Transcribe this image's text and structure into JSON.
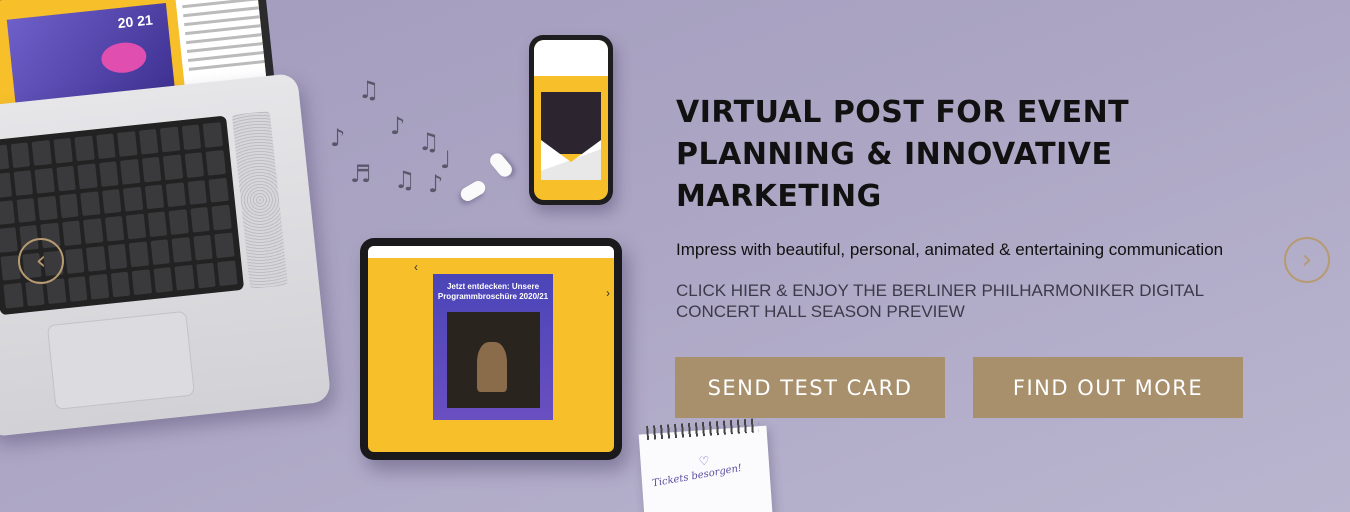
{
  "hero": {
    "headline": "VIRTUAL POST FOR EVENT PLANNING & INNOVATIVE MARKETING",
    "tagline": "Impress with beautiful, personal, animated & entertaining communication",
    "cta_text": "CLICK HIER & ENJOY THE BERLINER PHILHARMONIKER DIGITAL CONCERT HALL SEASON PREVIEW",
    "buttons": {
      "send_label": "SEND TEST CARD",
      "find_label": "FIND OUT MORE"
    }
  },
  "carousel": {
    "prev_icon": "chevron-left-icon",
    "next_icon": "chevron-right-icon",
    "prev_glyph": "‹",
    "next_glyph": "›"
  },
  "devices": {
    "laptop_year": "20 21",
    "tablet_headline": "Jetzt entdecken: Unsere Programmbroschüre 2020/21",
    "notepad_text": "Tickets besorgen!"
  },
  "colors": {
    "accent": "#a8906c",
    "arrow": "#b69a72",
    "background": "#aca6c4",
    "yellow": "#f7c02a"
  }
}
